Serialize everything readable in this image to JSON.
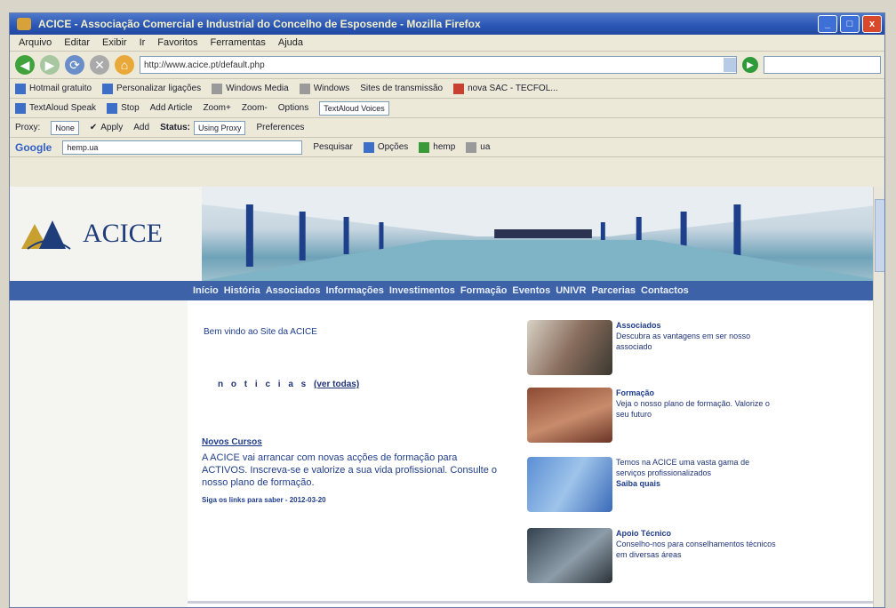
{
  "window": {
    "title": "ACICE - Associação Comercial e Industrial do Concelho de Esposende - Mozilla Firefox",
    "controls": {
      "minimize": "_",
      "maximize": "□",
      "close": "x"
    }
  },
  "menubar": [
    "Arquivo",
    "Editar",
    "Exibir",
    "Ir",
    "Favoritos",
    "Ferramentas",
    "Ajuda"
  ],
  "navbar": {
    "url": "http://www.acice.pt/default.php"
  },
  "bookmarks": [
    "Hotmail gratuito",
    "Personalizar ligações",
    "Windows Media",
    "Windows",
    "Sites de transmissão",
    "nova SAC - TECFOL..."
  ],
  "toolbar2": [
    "TextAloud Speak",
    "Stop",
    "Add Article",
    "Zoom+",
    "Zoom-",
    "Options",
    "TextAloud Voices"
  ],
  "toolbar3": {
    "proxy_label": "Proxy:",
    "proxy_value": "None",
    "apply": "Apply",
    "add": "Add",
    "status_label": "Status:",
    "status_value": "Using Proxy",
    "preferences": "Preferences"
  },
  "google_bar": {
    "logo": "Google",
    "query": "hemp.ua",
    "search": "Pesquisar",
    "options": "Opções",
    "hemp": "hemp",
    "ua": "ua"
  },
  "site": {
    "logo_text": "ACICE",
    "nav": [
      "Início",
      "História",
      "Associados",
      "Informações",
      "Investimentos",
      "Formação",
      "Eventos",
      "UNIVR",
      "Parcerias",
      "Contactos"
    ],
    "welcome": "Bem vindo ao Site da ACICE",
    "news_title": "n o t i c i a s",
    "news_link": "(ver todas)",
    "news_head": "Novos Cursos",
    "news_body": "A ACICE vai arrancar com novas acções de formação para ACTIVOS. Inscreva-se e valorize a sua vida profissional. Consulte o nosso plano de formação.",
    "news_meta": "Siga os links para saber - 2012-03-20",
    "cards": [
      {
        "title": "Associados",
        "text": "Descubra as vantagens em ser nosso associado"
      },
      {
        "title": "Formação",
        "text": "Veja o nosso plano de formação. Valorize o seu futuro"
      },
      {
        "title": "",
        "text": "Temos na ACICE uma vasta gama de serviços profissionalizados",
        "link": "Saiba quais"
      },
      {
        "title": "Apoio Técnico",
        "text": "Conselho-nos para conselhamentos técnicos em diversas áreas"
      }
    ]
  },
  "colors": {
    "title_bar": "#2a55b5",
    "site_nav": "#3d62a8",
    "text_blue": "#1f3d8a"
  }
}
